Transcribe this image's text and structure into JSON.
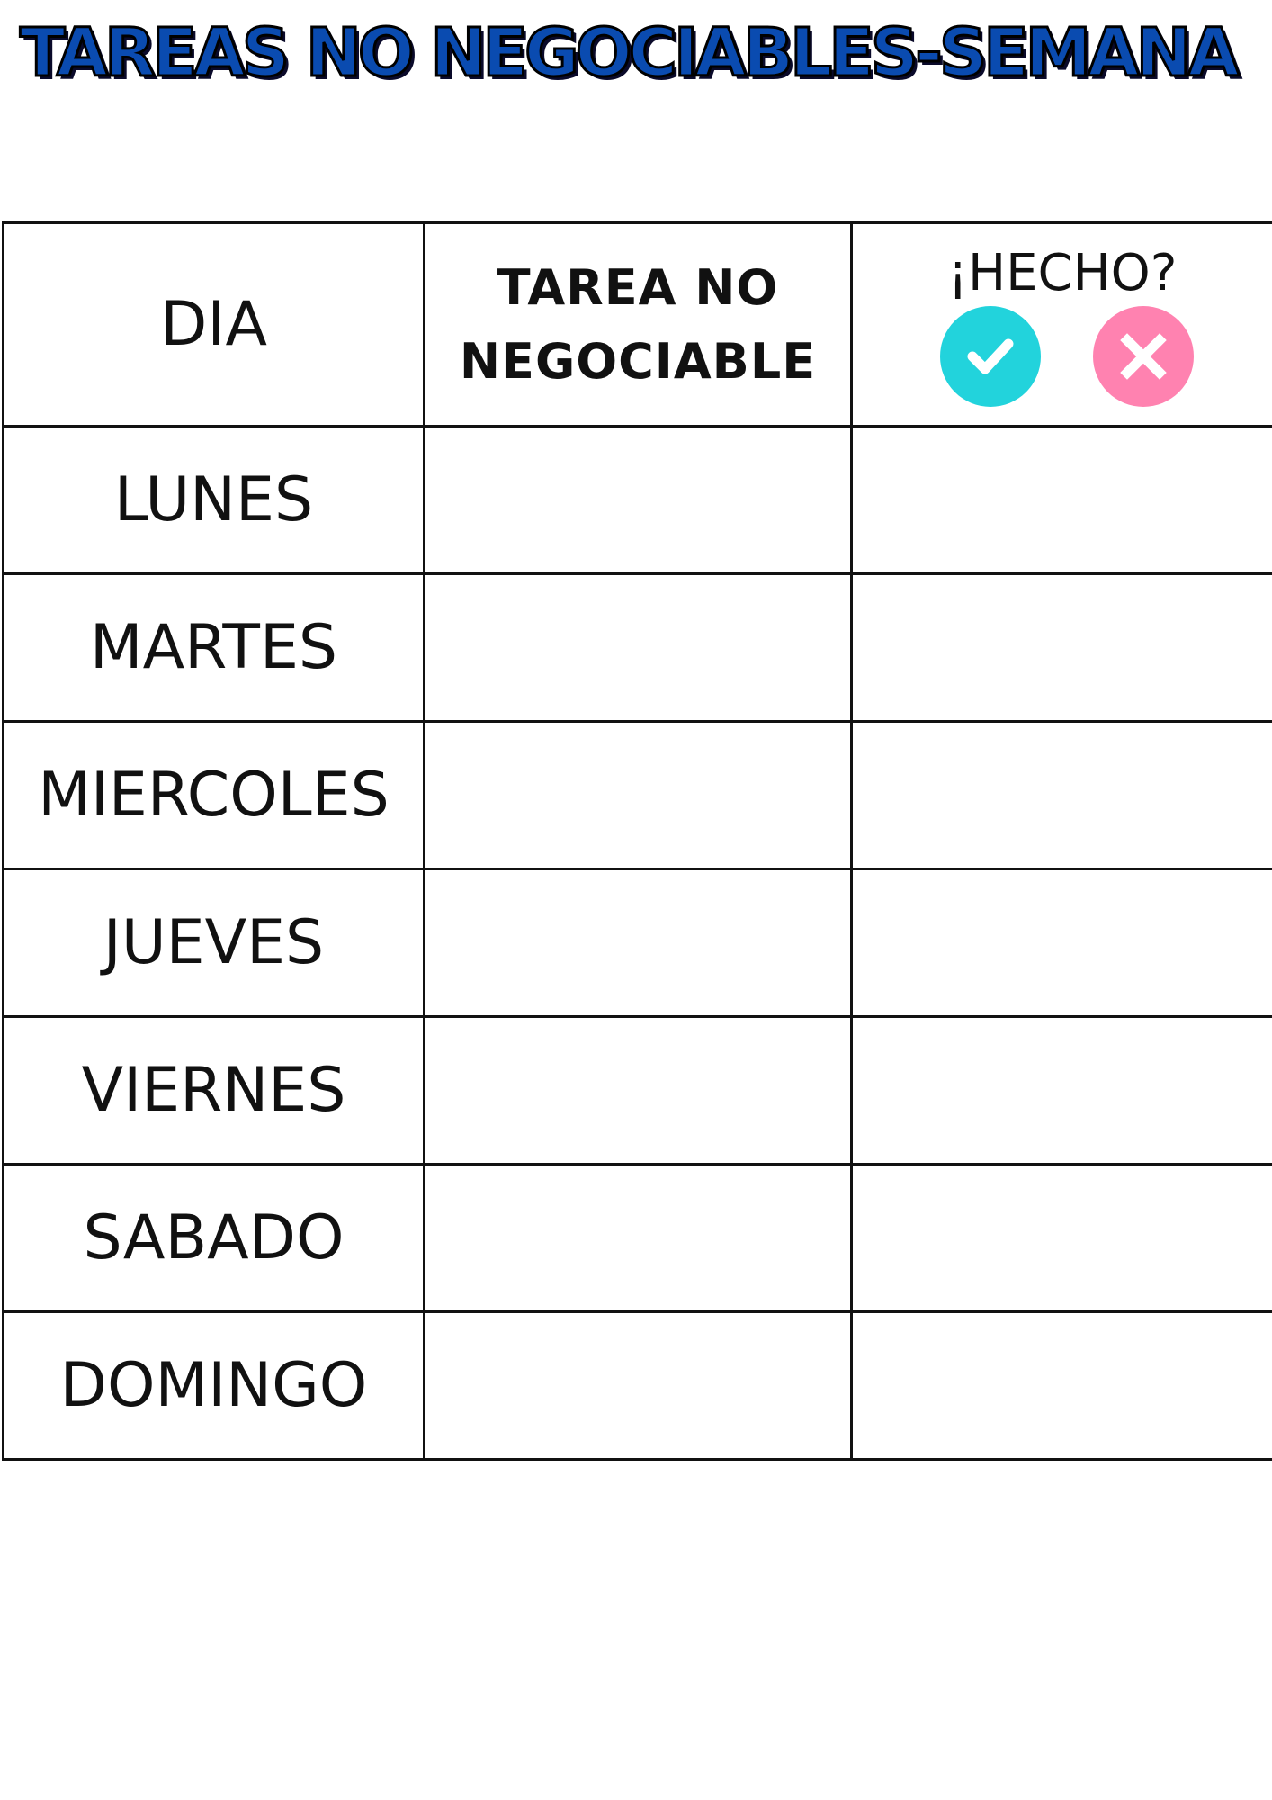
{
  "title": "TAREAS NO NEGOCIABLES-SEMANA",
  "table": {
    "headers": {
      "day": "DIA",
      "task_line1": "TAREA NO",
      "task_line2": "NEGOCIABLE",
      "done": "¡HECHO?"
    },
    "days": [
      "LUNES",
      "MARTES",
      "MIERCOLES",
      "JUEVES",
      "VIERNES",
      "SABADO",
      "DOMINGO"
    ],
    "tasks": [
      "",
      "",
      "",
      "",
      "",
      "",
      ""
    ],
    "done": [
      "",
      "",
      "",
      "",
      "",
      "",
      ""
    ]
  },
  "icons": {
    "check": "check-circle-icon",
    "cross": "cross-circle-icon"
  },
  "colors": {
    "title_fill": "#0a4bb0",
    "title_outline": "#000000",
    "check_circle": "#22d3dc",
    "cross_circle": "#ff82b0",
    "grid_lines": "#111111"
  }
}
